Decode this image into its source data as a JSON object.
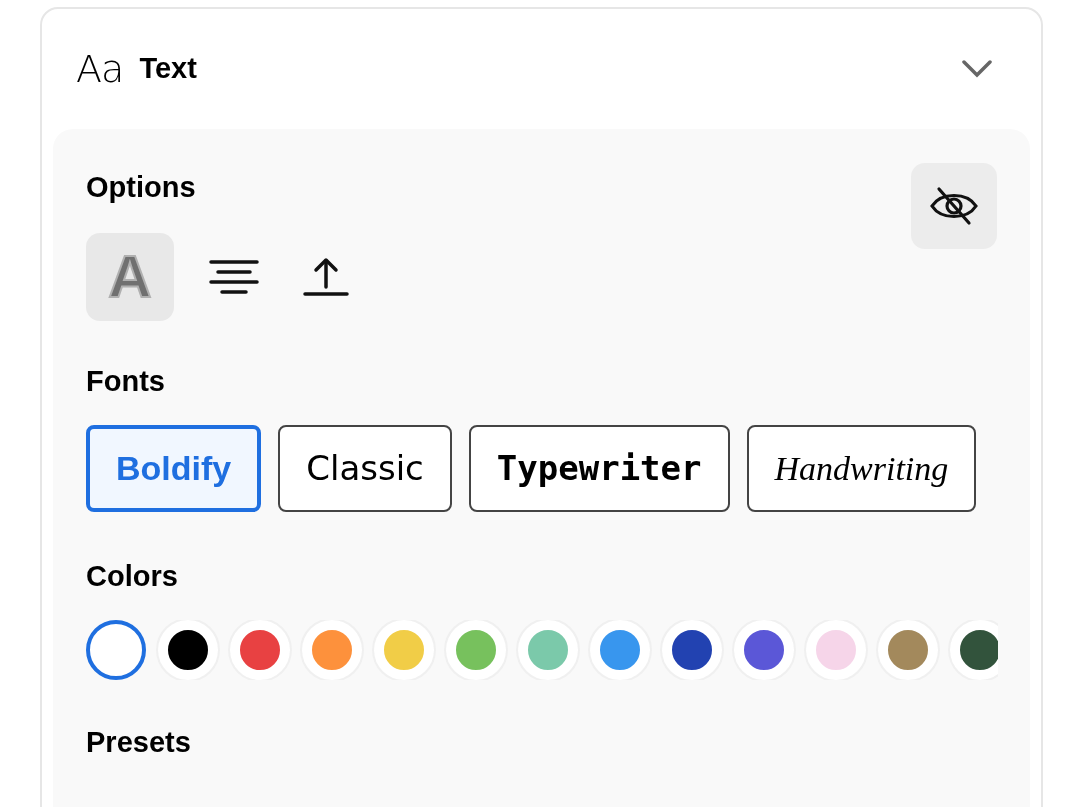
{
  "header": {
    "icon_label": "Aa",
    "title": "Text",
    "expanded": true
  },
  "options": {
    "title": "Options",
    "tools": [
      {
        "kind": "outline",
        "label": "A",
        "selected": true
      },
      {
        "kind": "align",
        "selected": false
      },
      {
        "kind": "upload",
        "selected": false
      }
    ]
  },
  "fonts": {
    "title": "Fonts",
    "items": [
      {
        "kind": "bold",
        "label": "Boldify",
        "selected": true
      },
      {
        "kind": "classic",
        "label": "Classic",
        "selected": false
      },
      {
        "kind": "mono",
        "label": "Typewriter",
        "selected": false
      },
      {
        "kind": "script",
        "label": "Handwriting",
        "selected": false
      }
    ]
  },
  "colors": {
    "title": "Colors",
    "items": [
      {
        "color": "#ffffff",
        "selected": true
      },
      {
        "color": "#000000",
        "selected": false
      },
      {
        "color": "#e84142",
        "selected": false
      },
      {
        "color": "#fd913c",
        "selected": false
      },
      {
        "color": "#f1cd47",
        "selected": false
      },
      {
        "color": "#77c15d",
        "selected": false
      },
      {
        "color": "#7bc9aa",
        "selected": false
      },
      {
        "color": "#3896ee",
        "selected": false
      },
      {
        "color": "#2242b1",
        "selected": false
      },
      {
        "color": "#5b57d7",
        "selected": false
      },
      {
        "color": "#f6d5e9",
        "selected": false
      },
      {
        "color": "#a3895c",
        "selected": false
      },
      {
        "color": "#32533c",
        "selected": false
      }
    ]
  },
  "presets": {
    "title": "Presets"
  }
}
